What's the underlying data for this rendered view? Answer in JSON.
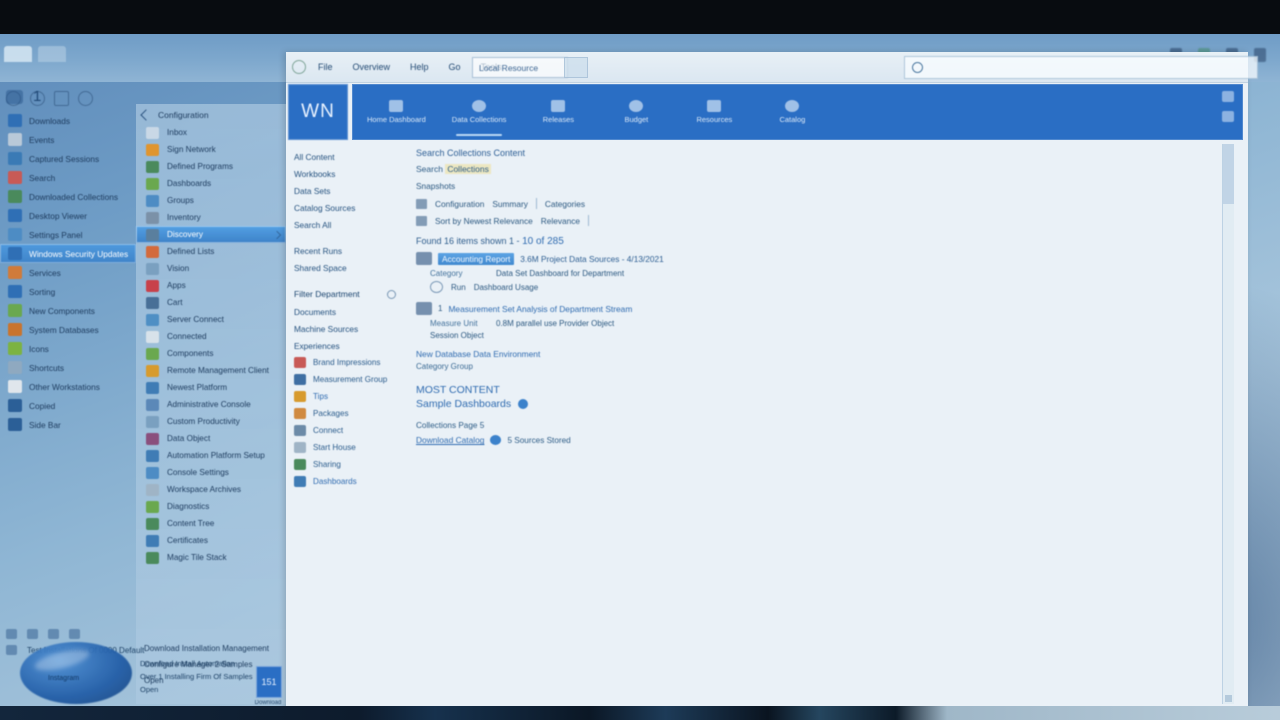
{
  "desktop": {
    "title_tabs": [
      "tab-1",
      "tab-2"
    ],
    "window_controls": [
      "minimize",
      "restore",
      "close",
      "menu"
    ]
  },
  "left_column": {
    "header_number": "1",
    "header_icon": "app-icon",
    "items": [
      {
        "label": "Downloads",
        "icon": "folder-icon",
        "color": "#2f6fb5"
      },
      {
        "label": "Events",
        "icon": "calendar-icon",
        "color": "#b9c9d8"
      },
      {
        "label": "Captured Sessions",
        "icon": "monitor-icon",
        "color": "#3a7ab5"
      },
      {
        "label": "Search",
        "icon": "search-icon",
        "color": "#c85a56"
      },
      {
        "label": "Downloaded Collections",
        "icon": "box-icon",
        "color": "#4a8a5c"
      },
      {
        "label": "Desktop Viewer",
        "icon": "screen-icon",
        "color": "#2f6fb5"
      },
      {
        "label": "Settings Panel",
        "icon": "gear-icon",
        "color": "#4d8cc4"
      },
      {
        "label": "Windows Security Updates",
        "icon": "shield-icon",
        "color": "#2f6fb5",
        "selected": true
      },
      {
        "label": "Services",
        "icon": "tools-icon",
        "color": "#d07b3a"
      },
      {
        "label": "Sorting",
        "icon": "sort-icon",
        "color": "#2f6fb5"
      },
      {
        "label": "New Components",
        "icon": "puzzle-icon",
        "color": "#6aa84f"
      },
      {
        "label": "System Databases",
        "icon": "database-icon",
        "color": "#c9742e"
      },
      {
        "label": "Icons",
        "icon": "leaf-icon",
        "color": "#7cb342"
      },
      {
        "label": "Shortcuts",
        "icon": "link-icon",
        "color": "#8fa9c0"
      },
      {
        "label": "Other Workstations",
        "icon": "book-icon",
        "color": "#e0e6ec"
      },
      {
        "label": "Copied",
        "icon": "bird-icon",
        "color": "#2b5f97"
      },
      {
        "label": "Side Bar",
        "icon": "bird-icon",
        "color": "#2b5f97"
      }
    ]
  },
  "menu_panel": {
    "title": "Configuration",
    "items": [
      {
        "label": "Inbox",
        "icon": "star-icon",
        "color": "#c9d8e6"
      },
      {
        "label": "Sign Network",
        "icon": "signal-icon",
        "color": "#e0952f"
      },
      {
        "label": "Defined Programs",
        "icon": "tree-icon",
        "color": "#4a8a5c"
      },
      {
        "label": "Dashboards",
        "icon": "grid-icon",
        "color": "#6aa84f"
      },
      {
        "label": "Groups",
        "icon": "group-icon",
        "color": "#4d8cc4"
      },
      {
        "label": "Inventory",
        "icon": "list-icon",
        "color": "#7b91a8"
      },
      {
        "label": "Discovery",
        "icon": "camera-icon",
        "color": "#5a7f9e",
        "selected": true,
        "has_arrow": true
      },
      {
        "label": "Defined Lists",
        "icon": "flame-icon",
        "color": "#d36a3c"
      },
      {
        "label": "Vision",
        "icon": "photo-icon",
        "color": "#7aa0c0"
      },
      {
        "label": "Apps",
        "icon": "apps-icon",
        "color": "#c8414a"
      },
      {
        "label": "Cart",
        "icon": "cart-icon",
        "color": "#486f97"
      },
      {
        "label": "Server Connect",
        "icon": "cloud-icon",
        "color": "#4f8fc4"
      },
      {
        "label": "Connected",
        "icon": "plug-icon",
        "color": "#d8e2ea"
      },
      {
        "label": "Components",
        "icon": "chip-icon",
        "color": "#6aa84f"
      },
      {
        "label": "Remote Management Client",
        "icon": "remote-icon",
        "color": "#d79b2e"
      },
      {
        "label": "Newest Platform",
        "icon": "badge-icon",
        "color": "#3f7cb5"
      },
      {
        "label": "Administrative Console",
        "icon": "console-icon",
        "color": "#5b88b8"
      },
      {
        "label": "Custom Productivity",
        "icon": "cube-icon",
        "color": "#7aa0c0"
      },
      {
        "label": "Data Object",
        "icon": "disc-icon",
        "color": "#8a4f7d"
      },
      {
        "label": "Automation Platform Setup",
        "icon": "wrench-icon",
        "color": "#3f7cb5"
      },
      {
        "label": "Console Settings",
        "icon": "slider-icon",
        "color": "#4d8cc4"
      },
      {
        "label": "Workspace Archives",
        "icon": "archive-icon",
        "color": "#9fb4c6"
      },
      {
        "label": "Diagnostics",
        "icon": "chart-icon",
        "color": "#6aa84f"
      },
      {
        "label": "Content Tree",
        "icon": "tree2-icon",
        "color": "#4a8a5c"
      },
      {
        "label": "Certificates",
        "icon": "cert-icon",
        "color": "#3f7cb5"
      },
      {
        "label": "Magic Tile Stack",
        "icon": "tile-icon",
        "color": "#4a8a5c"
      }
    ],
    "footer": {
      "line1": "Download Installation Management",
      "line2": "Configure Manager 2 Samples",
      "line3": "Open"
    }
  },
  "app_window": {
    "menubar": {
      "home_icon": "home-icon",
      "items": [
        "File",
        "Overview",
        "Help",
        "Go",
        "Tools"
      ],
      "address_value": "Local Resource",
      "go_button": "go-icon"
    },
    "search": {
      "placeholder": "",
      "icon": "search-icon"
    },
    "ribbon": {
      "brand": "WN",
      "nav": [
        {
          "label": "Home Dashboard",
          "icon": "home-icon",
          "active": false
        },
        {
          "label": "Data Collections",
          "icon": "cloud-icon",
          "active": true
        },
        {
          "label": "Releases",
          "icon": "tag-icon",
          "active": false
        },
        {
          "label": "Budget",
          "icon": "pie-icon",
          "active": false
        },
        {
          "label": "Resources",
          "icon": "stack-icon",
          "active": false
        },
        {
          "label": "Catalog",
          "icon": "book-icon",
          "active": false
        }
      ],
      "right_icons": [
        "account-icon",
        "grid-icon"
      ]
    },
    "sidebar": {
      "links": [
        "All Content",
        "Workbooks",
        "Data Sets",
        "Catalog Sources",
        "Search All"
      ],
      "links2": [
        "Recent Runs",
        "Shared Space"
      ],
      "section_header": "Filter Department",
      "section_header_icon": "info-icon",
      "sub_links": [
        "Documents",
        "Machine Sources"
      ],
      "group_title": "Experiences",
      "items": [
        {
          "label": "Brand Impressions",
          "icon": "brand-icon",
          "color": "#c85a56"
        },
        {
          "label": "Measurement Group",
          "icon": "gauge-icon",
          "color": "#3f6fa3"
        },
        {
          "label": "Tips",
          "icon": "bulb-icon",
          "color": "#d79b2e",
          "link": true
        },
        {
          "label": "Packages",
          "icon": "package-icon",
          "color": "#d08a40"
        },
        {
          "label": "Connect",
          "icon": "connect-icon",
          "color": "#6c8ba8"
        },
        {
          "label": "Start House",
          "icon": "house-icon",
          "color": "#9fb4c6"
        },
        {
          "label": "Sharing",
          "icon": "share-icon",
          "color": "#4a8a5c"
        },
        {
          "label": "Dashboards",
          "icon": "dash-icon",
          "color": "#3f7cb5",
          "link": true
        }
      ]
    },
    "main": {
      "title": "Search Collections Content",
      "subtitle_prefix": "Search",
      "subtitle_highlight": "Collections",
      "line_small": "Snapshots",
      "meta_rows": [
        {
          "tag_icon": "list-icon",
          "label": "Configuration",
          "value": "Summary",
          "extra": "Categories"
        },
        {
          "tag_icon": "filter-icon",
          "label": "Sort by Newest Relevance",
          "value": "Relevance"
        }
      ],
      "results_header_prefix": "Found 16 items shown 1 -",
      "results_header_count": "10 of 285",
      "results": [
        {
          "icon": "doc-icon",
          "selected_text": "Accounting Report",
          "rest": "3.6M Project Data Sources - 4/13/2021",
          "detail_label": "Category",
          "detail_value": "Data Set Dashboard for Department",
          "sub_icon": "clock-icon",
          "sub_label": "Run",
          "sub_value": "Dashboard Usage"
        },
        {
          "icon": "chart-icon",
          "badge": "1",
          "selected_text": "",
          "rest": "",
          "link_line": "Measurement Set Analysis of Department Stream",
          "detail_label": "Measure Unit",
          "detail_value": "0.8M parallel use Provider Object",
          "sub_value": "Session Object"
        }
      ],
      "mid_link": "New Database Data Environment",
      "mid_small": "Category Group",
      "big_blue_line1": "MOST CONTENT",
      "big_blue_line2": "Sample Dashboards",
      "footer_note": "Collections Page 5",
      "footer_link": "Download Catalog",
      "footer_rest": "5 Sources Stored"
    },
    "scrollbar": {
      "position": "top"
    }
  },
  "footer_desktop": {
    "glyph_row": [
      "back-icon",
      "forward-icon",
      "refresh-icon",
      "stop-icon"
    ],
    "line1": "Test Installations Of 0000 Default",
    "orb_label": "Instagram",
    "center_notes": [
      "Download Install Automation",
      "Over 1 Installing Firm Of Samples",
      "Open"
    ],
    "badge": "151",
    "badge_caption": "Download"
  }
}
